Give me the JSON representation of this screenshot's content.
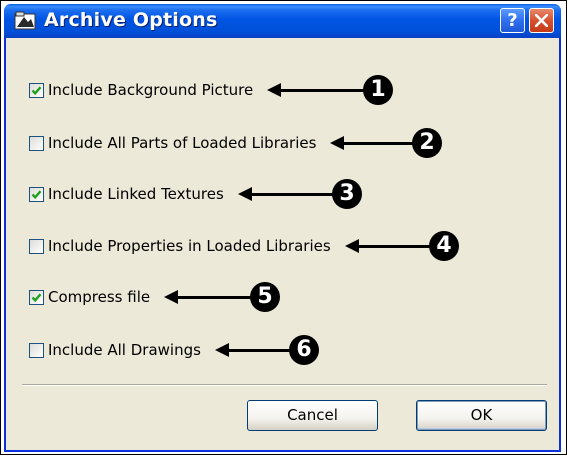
{
  "window": {
    "title": "Archive Options",
    "help_label": "?",
    "title_bar_color": "#0054e3",
    "body_color": "#ece9d8"
  },
  "options": [
    {
      "label": "Include Background Picture",
      "checked": true,
      "badge": "1"
    },
    {
      "label": "Include All Parts of Loaded Libraries",
      "checked": false,
      "badge": "2"
    },
    {
      "label": "Include Linked Textures",
      "checked": true,
      "badge": "3"
    },
    {
      "label": "Include Properties in Loaded Libraries",
      "checked": false,
      "badge": "4"
    },
    {
      "label": "Compress file",
      "checked": true,
      "badge": "5"
    },
    {
      "label": "Include All Drawings",
      "checked": false,
      "badge": "6"
    }
  ],
  "buttons": {
    "cancel_label": "Cancel",
    "ok_label": "OK"
  },
  "icons": {
    "app": "archicad-app-icon",
    "help": "help-icon",
    "close": "close-icon",
    "check": "checkmark-icon"
  },
  "colors": {
    "check": "#21a121",
    "badge": "#000000",
    "checkbox_border": "#1c5180"
  }
}
